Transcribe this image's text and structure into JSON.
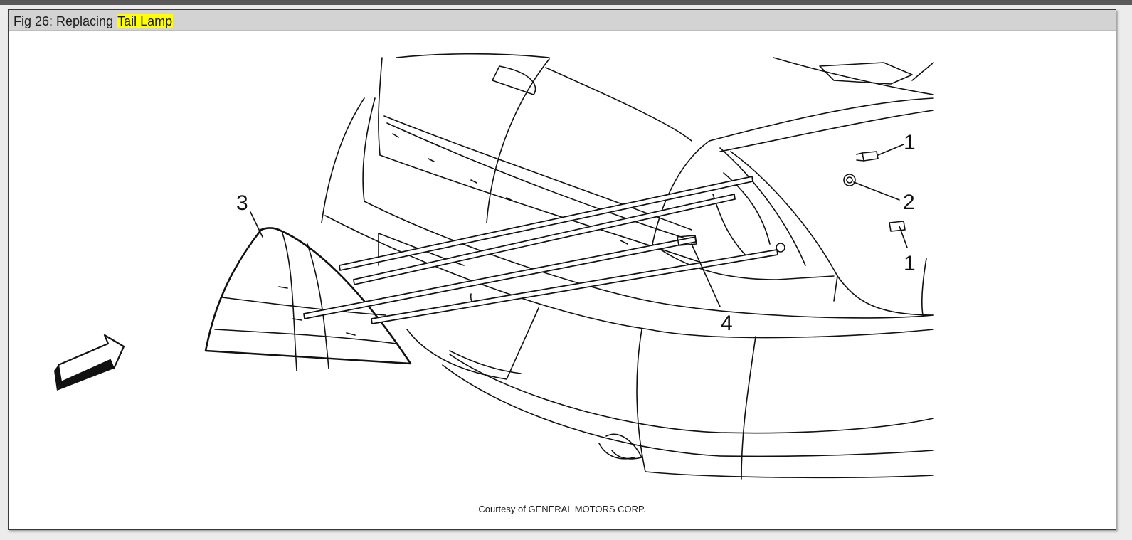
{
  "figure": {
    "caption_prefix": "Fig 26: Replacing ",
    "caption_highlight": "Tail Lamp",
    "credit": "Courtesy of GENERAL MOTORS CORP.",
    "callouts": [
      "1",
      "2",
      "1",
      "3",
      "4"
    ],
    "highlight_color": "#ffff00"
  }
}
